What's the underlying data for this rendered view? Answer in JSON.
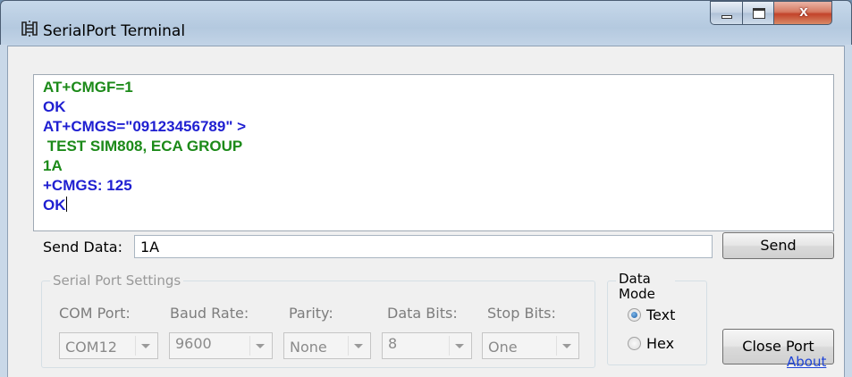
{
  "window": {
    "title": "SerialPort Terminal",
    "buttons": {
      "minimize": "minimize",
      "maximize": "maximize",
      "close": "x"
    }
  },
  "terminal": {
    "lines": [
      {
        "text": "AT+CMGF=1",
        "color": "green"
      },
      {
        "text": "OK",
        "color": "blue"
      },
      {
        "text": "AT+CMGS=\"09123456789\" >",
        "color": "blue"
      },
      {
        "text": " TEST SIM808, ECA GROUP",
        "color": "green"
      },
      {
        "text": "1A",
        "color": "green"
      },
      {
        "text": "+CMGS: 125",
        "color": "blue"
      },
      {
        "text": "OK",
        "color": "blue"
      }
    ]
  },
  "send": {
    "label": "Send Data:",
    "value": "1A",
    "button": "Send"
  },
  "serial_settings": {
    "group_title": "Serial Port Settings",
    "com_port": {
      "label": "COM Port:",
      "value": "COM12"
    },
    "baud_rate": {
      "label": "Baud Rate:",
      "value": "9600"
    },
    "parity": {
      "label": "Parity:",
      "value": "None"
    },
    "data_bits": {
      "label": "Data Bits:",
      "value": "8"
    },
    "stop_bits": {
      "label": "Stop Bits:",
      "value": "One"
    }
  },
  "data_mode": {
    "group_title": "Data Mode",
    "options": [
      {
        "label": "Text",
        "selected": true
      },
      {
        "label": "Hex",
        "selected": false
      }
    ]
  },
  "close_port_button": "Close Port",
  "about_link": "About",
  "colors": {
    "green_text": "#1c8a19",
    "blue_text": "#1f1fd1",
    "link": "#1f44d6"
  }
}
